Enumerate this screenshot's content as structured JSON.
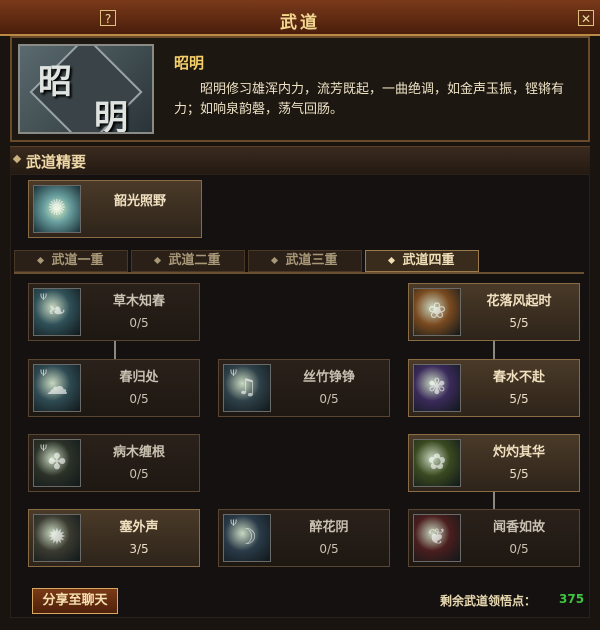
{
  "window": {
    "title": "武道",
    "help_label": "?",
    "close_label": "✕"
  },
  "header": {
    "avatar_chars": [
      "昭",
      "明"
    ],
    "skill_name": "昭明",
    "description": "昭明修习雄浑内力，流芳既起，一曲绝调，如金声玉振，铿锵有力；如响泉韵磬，荡气回肠。"
  },
  "section": {
    "title": "武道精要"
  },
  "featured": {
    "name": "韶光照野",
    "icon": "radiant-burst-icon"
  },
  "tabs": [
    {
      "label": "武道一重",
      "active": false
    },
    {
      "label": "武道二重",
      "active": false
    },
    {
      "label": "武道三重",
      "active": false
    },
    {
      "label": "武道四重",
      "active": true
    }
  ],
  "skills": [
    {
      "name": "草木知春",
      "level": "0/5",
      "icon": "grass-spring-icon",
      "color": "#2f5058"
    },
    {
      "name": "花落风起时",
      "level": "5/5",
      "icon": "falling-flower-icon",
      "color": "#7a4a20"
    },
    {
      "name": "春归处",
      "level": "0/5",
      "icon": "spring-return-icon",
      "color": "#2e4a52"
    },
    {
      "name": "丝竹铮铮",
      "level": "0/5",
      "icon": "strings-icon",
      "color": "#2e4048"
    },
    {
      "name": "春水不赴",
      "level": "5/5",
      "icon": "spring-water-icon",
      "color": "#3a2a5a"
    },
    {
      "name": "病木缠根",
      "level": "0/5",
      "icon": "withered-root-icon",
      "color": "#2c3228"
    },
    {
      "name": "灼灼其华",
      "level": "5/5",
      "icon": "blazing-bloom-icon",
      "color": "#3a4a20"
    },
    {
      "name": "塞外声",
      "level": "3/5",
      "icon": "frontier-sound-icon",
      "color": "#3a3a30"
    },
    {
      "name": "醉花阴",
      "level": "0/5",
      "icon": "drunk-flower-icon",
      "color": "#2a3a48"
    },
    {
      "name": "闻香如故",
      "level": "0/5",
      "icon": "fragrance-icon",
      "color": "#4a1e1e"
    }
  ],
  "footer": {
    "share_label": "分享至聊天",
    "remaining_label": "剩余武道领悟点：",
    "remaining_value": "375"
  }
}
